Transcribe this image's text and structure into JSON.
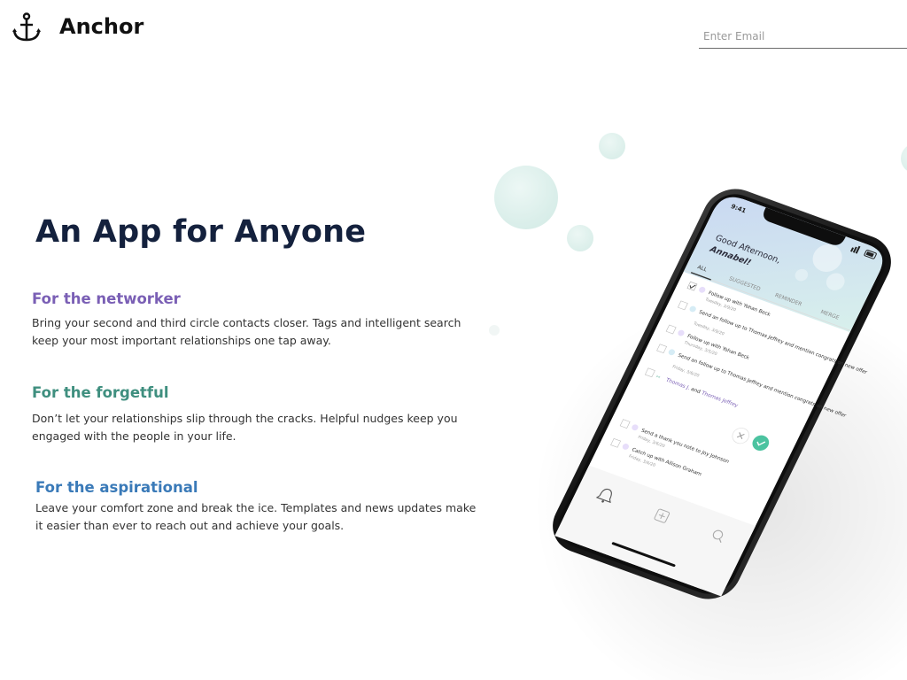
{
  "brand": {
    "name": "Anchor",
    "logo_icon": "anchor-icon"
  },
  "email": {
    "placeholder": "Enter Email",
    "value": ""
  },
  "hero": {
    "title": "An App for Anyone"
  },
  "features": [
    {
      "title": "For the networker",
      "color": "#7a5fb5",
      "text": "Bring your second and third circle contacts closer. Tags and intelligent search keep your most important relationships one tap away."
    },
    {
      "title": "For the forgetful",
      "color": "#3f8f7f",
      "text": "Don’t let your relationships slip through the cracks. Helpful nudges keep you engaged with the people in your life."
    },
    {
      "title": "For the aspirational",
      "color": "#3a7ab8",
      "text": "Leave your comfort zone and break the ice. Templates and news updates make it easier than ever to reach out and achieve your goals."
    }
  ],
  "phone": {
    "time": "9:41",
    "greeting_line1": "Good Afternoon,",
    "greeting_name": "Annabel",
    "greeting_punct": "!",
    "tabs": [
      "ALL",
      "SUGGESTED",
      "REMINDER",
      "MERGE"
    ],
    "tasks": [
      {
        "title": "Follow up with Yohan Beck",
        "date": "Tuesday, 3/9/20",
        "checked": true
      },
      {
        "title": "Send an follow up to Thomas Jeffrey and mention congrats on new offer",
        "date": "Tuesday, 3/9/20",
        "checked": false
      },
      {
        "title": "Follow up with Yohan Beck",
        "date": "Thursday, 3/5/20",
        "checked": false
      },
      {
        "title": "Send an follow up to Thomas Jeffrey and mention congrats on new offer",
        "date": "Friday, 3/6/20",
        "checked": false
      },
      {
        "title": "Send a thank you note to Joy Johnson",
        "date": "Friday, 3/6/20",
        "checked": false
      },
      {
        "title": "Catch up with Allison Graham",
        "date": "Friday, 3/6/20",
        "checked": false
      }
    ],
    "merge": {
      "name_a": "Thomas J.",
      "joiner": " and ",
      "name_b": "Thomas Jeffrey"
    },
    "icons": [
      "bell-icon",
      "add-icon",
      "search-icon",
      "close-icon",
      "check-icon"
    ],
    "accent": "#4cc3a0"
  }
}
